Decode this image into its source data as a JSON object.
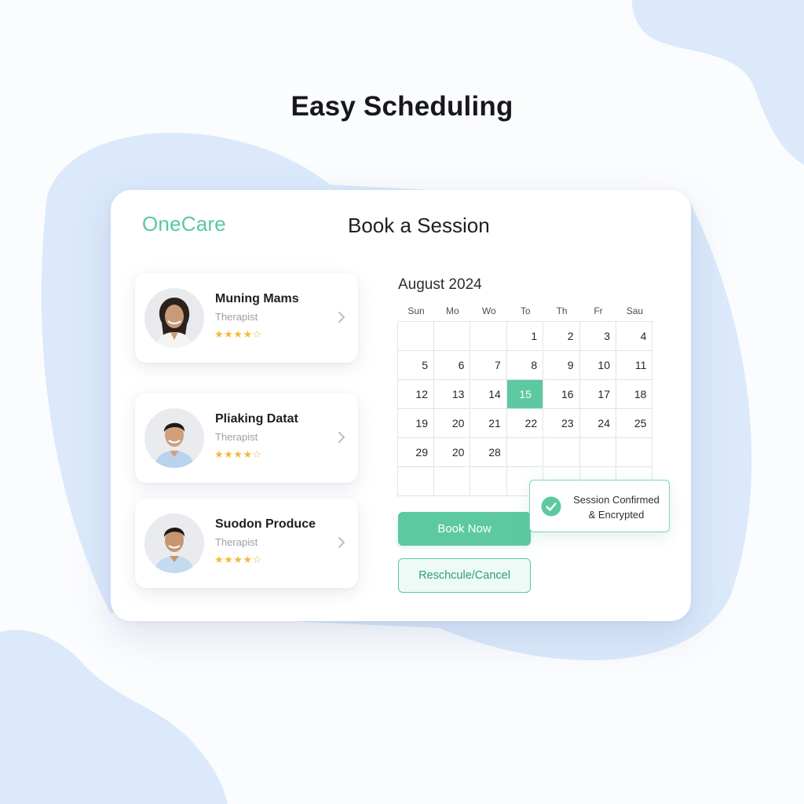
{
  "headline": "Easy Scheduling",
  "panel": {
    "brand": "OneCare",
    "title": "Book a Session"
  },
  "therapists": [
    {
      "name": "Muning Mams",
      "role": "Therapist",
      "rating": 4.5,
      "stars": "★★★★☆",
      "avatar": "female-avatar"
    },
    {
      "name": "Pliaking Datat",
      "role": "Therapist",
      "rating": 4.5,
      "stars": "★★★★☆",
      "avatar": "male-avatar"
    },
    {
      "name": "Suodon Produce",
      "role": "Therapist",
      "rating": 4.5,
      "stars": "★★★★☆",
      "avatar": "male-avatar"
    }
  ],
  "calendar": {
    "month_label": "August 2024",
    "weekdays": [
      "Sun",
      "Mo",
      "Wo",
      "To",
      "Th",
      "Fr",
      "Sau"
    ],
    "weeks": [
      [
        "",
        "",
        "",
        "1",
        "2",
        "3",
        "4"
      ],
      [
        "5",
        "6",
        "7",
        "8",
        "9",
        "10",
        "11"
      ],
      [
        "12",
        "13",
        "14",
        "15",
        "16",
        "17",
        "18"
      ],
      [
        "19",
        "20",
        "21",
        "22",
        "23",
        "24",
        "25"
      ],
      [
        "29",
        "20",
        "28",
        "",
        "",
        "",
        ""
      ],
      [
        "",
        "",
        "",
        "",
        "",
        "",
        ""
      ]
    ],
    "selected_day": "15"
  },
  "actions": {
    "book_label": "Book Now",
    "reschedule_label": "Reschcule/Cancel"
  },
  "toast": {
    "line1": "Session Confirmed",
    "line2": "& Encrypted",
    "icon": "check-circle-icon"
  },
  "colors": {
    "accent": "#5cc9a0",
    "brand": "#5ac8a0",
    "background_blob": "#dbe9fb",
    "star": "#f3b93a"
  }
}
